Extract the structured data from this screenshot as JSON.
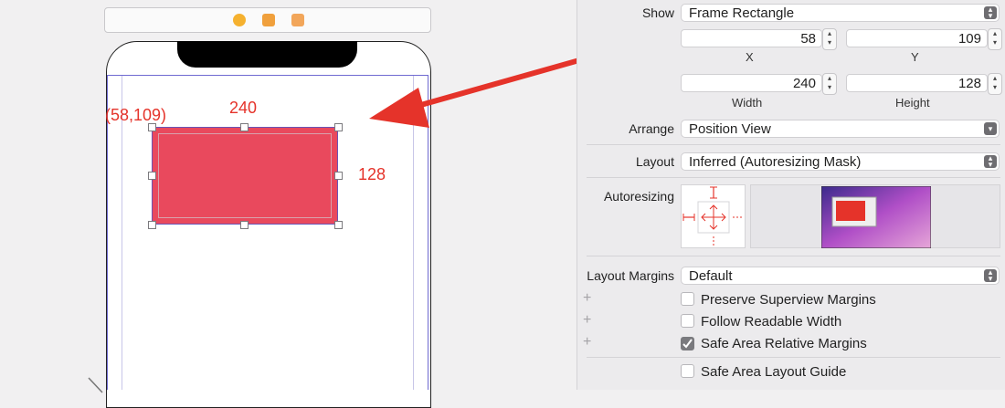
{
  "annotation": {
    "origin": "(58,109)",
    "width": "240",
    "height": "128"
  },
  "inspector": {
    "show": {
      "label": "Show",
      "value": "Frame Rectangle"
    },
    "x": {
      "value": "58",
      "label": "X"
    },
    "y": {
      "value": "109",
      "label": "Y"
    },
    "width": {
      "value": "240",
      "label": "Width"
    },
    "height": {
      "value": "128",
      "label": "Height"
    },
    "arrange": {
      "label": "Arrange",
      "value": "Position View"
    },
    "layout": {
      "label": "Layout",
      "value": "Inferred (Autoresizing Mask)"
    },
    "autoresizing": {
      "label": "Autoresizing"
    },
    "layout_margins": {
      "label": "Layout Margins",
      "value": "Default"
    },
    "checkboxes": [
      {
        "label": "Preserve Superview Margins",
        "checked": false
      },
      {
        "label": "Follow Readable Width",
        "checked": false
      },
      {
        "label": "Safe Area Relative Margins",
        "checked": true
      },
      {
        "label": "Safe Area Layout Guide",
        "checked": false
      }
    ]
  },
  "icons": {
    "scene_bar": [
      "view-controller-icon",
      "first-responder-icon",
      "exit-icon"
    ],
    "popup": "chevron-updown-icon",
    "stepper": "stepper-icon",
    "checkmark": "checkmark-icon",
    "plus": "plus-icon"
  },
  "colors": {
    "red_view": "#e9495d",
    "annotation": "#e5332a",
    "selection": "#6a54b5"
  }
}
